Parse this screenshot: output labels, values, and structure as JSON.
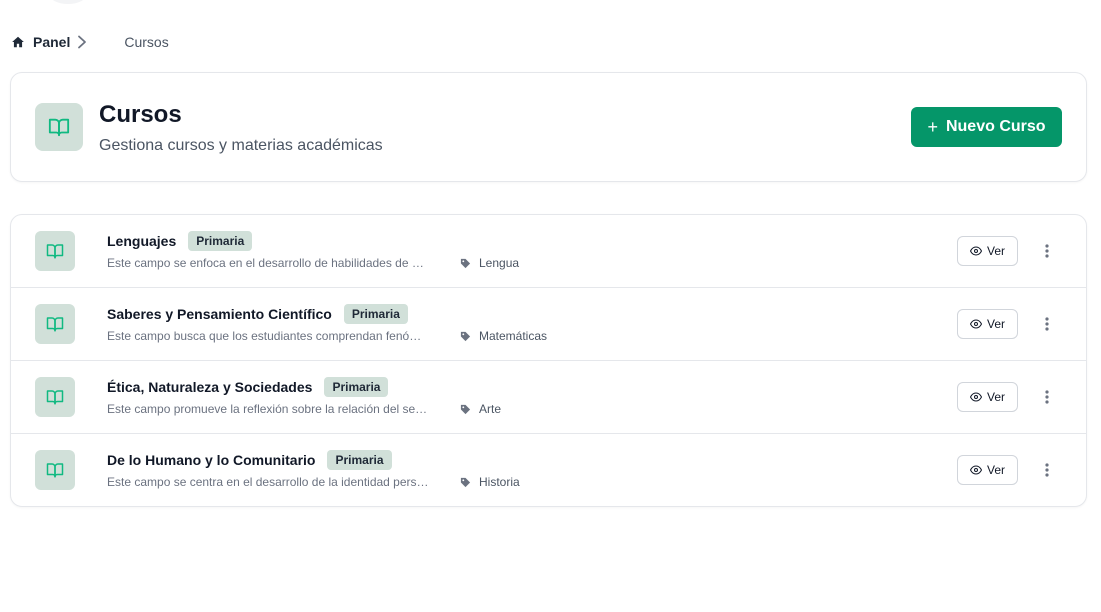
{
  "breadcrumb": {
    "home_label": "Panel",
    "current_label": "Cursos"
  },
  "header": {
    "title": "Cursos",
    "subtitle": "Gestiona cursos y materias académicas",
    "new_button_label": "Nuevo Curso",
    "new_button_icon": "plus-icon",
    "icon": "book-open-icon"
  },
  "courses": [
    {
      "title": "Lenguajes",
      "level": "Primaria",
      "description": "Este campo se enfoca en el desarrollo de habilidades de comunicación oral y escrita",
      "subject": "Lengua",
      "view_label": "Ver"
    },
    {
      "title": "Saberes y Pensamiento Científico",
      "level": "Primaria",
      "description": "Este campo busca que los estudiantes comprendan fenómenos naturales y sociales",
      "subject": "Matemáticas",
      "view_label": "Ver"
    },
    {
      "title": "Ética, Naturaleza y Sociedades",
      "level": "Primaria",
      "description": "Este campo promueve la reflexión sobre la relación del ser humano con la naturaleza",
      "subject": "Arte",
      "view_label": "Ver"
    },
    {
      "title": "De lo Humano y lo Comunitario",
      "level": "Primaria",
      "description": "Este campo se centra en el desarrollo de la identidad personal y comunitaria",
      "subject": "Historia",
      "view_label": "Ver"
    }
  ],
  "colors": {
    "accent": "#059669",
    "icon_bg": "#d1e0d9",
    "icon_fg": "#10b981"
  }
}
